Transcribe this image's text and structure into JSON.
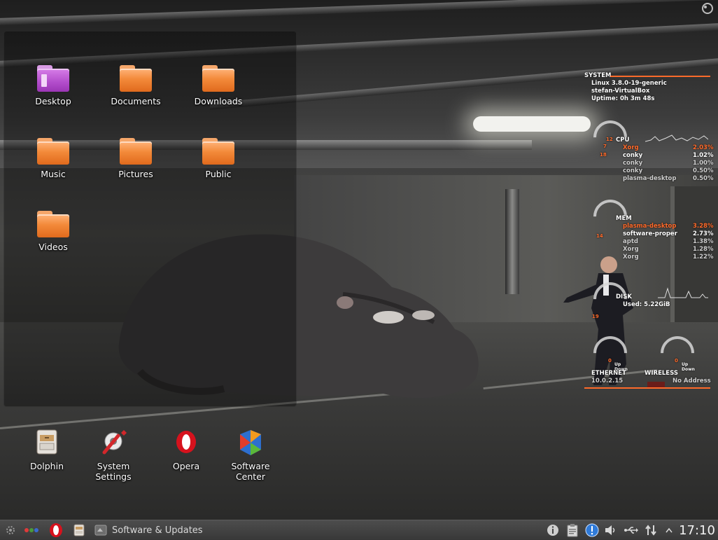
{
  "desktop": {
    "folder_view": [
      {
        "label": "Desktop",
        "icon": "desktop-folder-icon",
        "color": "#b24ccb"
      },
      {
        "label": "Documents",
        "icon": "folder-icon",
        "color": "#f38a3a"
      },
      {
        "label": "Downloads",
        "icon": "folder-icon",
        "color": "#f38a3a"
      },
      {
        "label": "Music",
        "icon": "folder-icon",
        "color": "#f38a3a"
      },
      {
        "label": "Pictures",
        "icon": "folder-icon",
        "color": "#f38a3a"
      },
      {
        "label": "Public",
        "icon": "folder-icon",
        "color": "#f38a3a"
      },
      {
        "label": "Videos",
        "icon": "folder-icon",
        "color": "#f38a3a"
      }
    ],
    "launchers": [
      {
        "label": "Dolphin",
        "icon": "file-manager-icon"
      },
      {
        "label": "System\nSettings",
        "icon": "settings-icon"
      },
      {
        "label": "Opera",
        "icon": "opera-icon"
      },
      {
        "label": "Software\nCenter",
        "icon": "software-center-icon"
      }
    ]
  },
  "conky": {
    "accent": "#ff6a2a",
    "system": {
      "header": "SYSTEM",
      "kernel": "Linux 3.8.0-19-generic",
      "host": "stefan-VirtualBox",
      "uptime": "Uptime: 0h 3m 48s"
    },
    "cpu": {
      "header": "CPU",
      "ring_values": [
        "12",
        "7",
        "18"
      ],
      "processes": [
        {
          "name": "Xorg",
          "value": "2.03%"
        },
        {
          "name": "conky",
          "value": "1.02%"
        },
        {
          "name": "conky",
          "value": "1.00%"
        },
        {
          "name": "conky",
          "value": "0.50%"
        },
        {
          "name": "plasma-desktop",
          "value": "0.50%"
        }
      ]
    },
    "mem": {
      "header": "MEM",
      "ring_value": "14",
      "processes": [
        {
          "name": "plasma-desktop",
          "value": "3.28%"
        },
        {
          "name": "software-proper",
          "value": "2.73%"
        },
        {
          "name": "aptd",
          "value": "1.38%"
        },
        {
          "name": "Xorg",
          "value": "1.28%"
        },
        {
          "name": "Xorg",
          "value": "1.22%"
        }
      ]
    },
    "disk": {
      "header": "DISK",
      "used": "Used: 5.22GiB",
      "ring_value": "19"
    },
    "network": {
      "ethernet": {
        "header": "ETHERNET",
        "ip": "10.0.2.15",
        "ring_value": "0",
        "up": "Up",
        "down": "Down"
      },
      "wireless": {
        "header": "WIRELESS",
        "ip": "No Address",
        "ring_value": "0",
        "up": "Up",
        "down": "Down"
      }
    }
  },
  "taskbar": {
    "task_title": "Software & Updates",
    "clock": "17:10",
    "launcher_icons": [
      "kde-menu-icon",
      "activities-icon",
      "opera-icon",
      "dolphin-icon"
    ],
    "tray_icons": [
      "info-icon",
      "clipboard-icon",
      "notification-icon",
      "volume-icon",
      "usb-icon",
      "network-icon",
      "expand-icon"
    ]
  }
}
